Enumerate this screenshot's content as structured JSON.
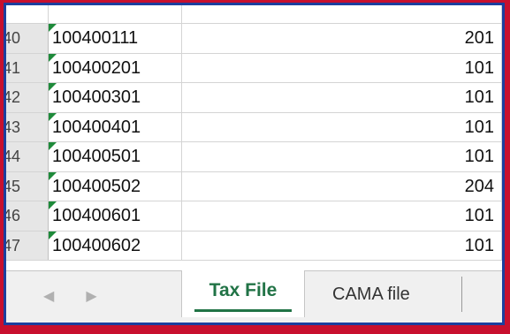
{
  "rows": [
    {
      "num": "40",
      "a": "100400111",
      "b": "201"
    },
    {
      "num": "41",
      "a": "100400201",
      "b": "101"
    },
    {
      "num": "42",
      "a": "100400301",
      "b": "101"
    },
    {
      "num": "43",
      "a": "100400401",
      "b": "101"
    },
    {
      "num": "44",
      "a": "100400501",
      "b": "101"
    },
    {
      "num": "45",
      "a": "100400502",
      "b": "204"
    },
    {
      "num": "46",
      "a": "100400601",
      "b": "101"
    },
    {
      "num": "47",
      "a": "100400602",
      "b": "101"
    }
  ],
  "nav": {
    "prev_icon": "◀",
    "next_icon": "▶"
  },
  "tabs": [
    {
      "label": "Tax File",
      "active": true
    },
    {
      "label": "CAMA file",
      "active": false
    }
  ],
  "colors": {
    "accent": "#217346",
    "comment_marker": "#1e8a3a",
    "frame": "#1c3f9e",
    "background": "#c8102e"
  }
}
